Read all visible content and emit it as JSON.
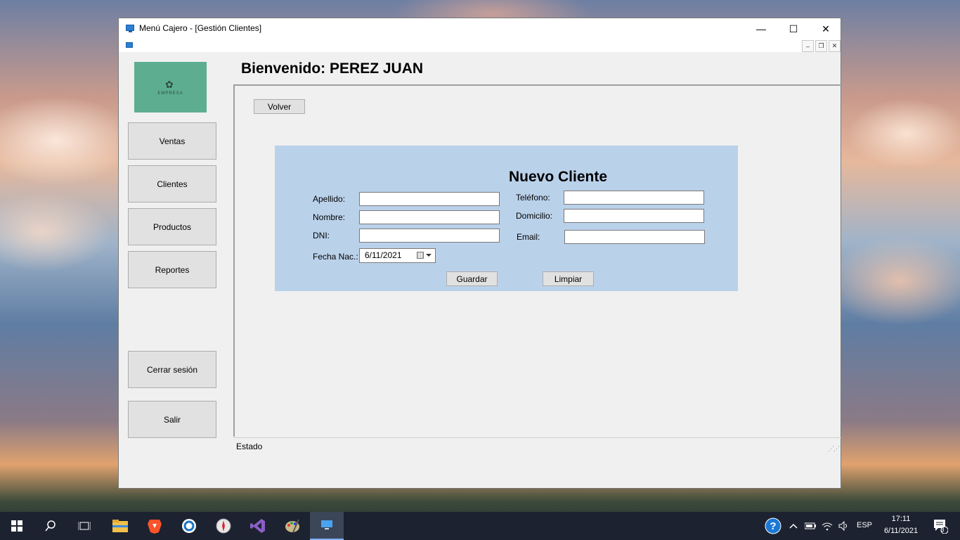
{
  "window": {
    "title": "Menú Cajero - [Gestión Clientes]",
    "minimize_glyph": "—",
    "maximize_glyph": "☐",
    "close_glyph": "✕",
    "mdi_minimize_glyph": "–",
    "mdi_restore_glyph": "❐",
    "mdi_close_glyph": "✕"
  },
  "logo": {
    "text": "EMPRESA",
    "icon": "tree-icon"
  },
  "sidebar": {
    "items": [
      {
        "label": "Ventas"
      },
      {
        "label": "Clientes"
      },
      {
        "label": "Productos"
      },
      {
        "label": "Reportes"
      }
    ],
    "logout_label": "Cerrar sesión",
    "exit_label": "Salir"
  },
  "header": {
    "welcome": "Bienvenido: PEREZ JUAN"
  },
  "main": {
    "back_label": "Volver",
    "form": {
      "title": "Nuevo Cliente",
      "fields": {
        "apellido": {
          "label": "Apellido:",
          "value": ""
        },
        "nombre": {
          "label": "Nombre:",
          "value": ""
        },
        "dni": {
          "label": "DNI:",
          "value": ""
        },
        "fecha": {
          "label": "Fecha Nac.:",
          "value": "6/11/2021"
        },
        "telefono": {
          "label": "Teléfono:",
          "value": ""
        },
        "domicilio": {
          "label": "Domicilio:",
          "value": ""
        },
        "email": {
          "label": "Email:",
          "value": ""
        }
      },
      "save_label": "Guardar",
      "clear_label": "Limpiar"
    }
  },
  "statusbar": {
    "text": "Estado"
  },
  "taskbar": {
    "apps": [
      "start-icon",
      "search-icon",
      "task-view-icon",
      "file-explorer-icon",
      "brave-icon",
      "browser-icon",
      "compass-icon",
      "visual-studio-icon",
      "paint-icon",
      "app-window-icon"
    ],
    "tray": {
      "language": "ESP",
      "time": "17:11",
      "date": "6/11/2021",
      "notifications": "3"
    }
  },
  "colors": {
    "form_bg": "#bad1ea",
    "logo_bg": "#5dae91",
    "taskbar_bg": "#1c2230"
  }
}
